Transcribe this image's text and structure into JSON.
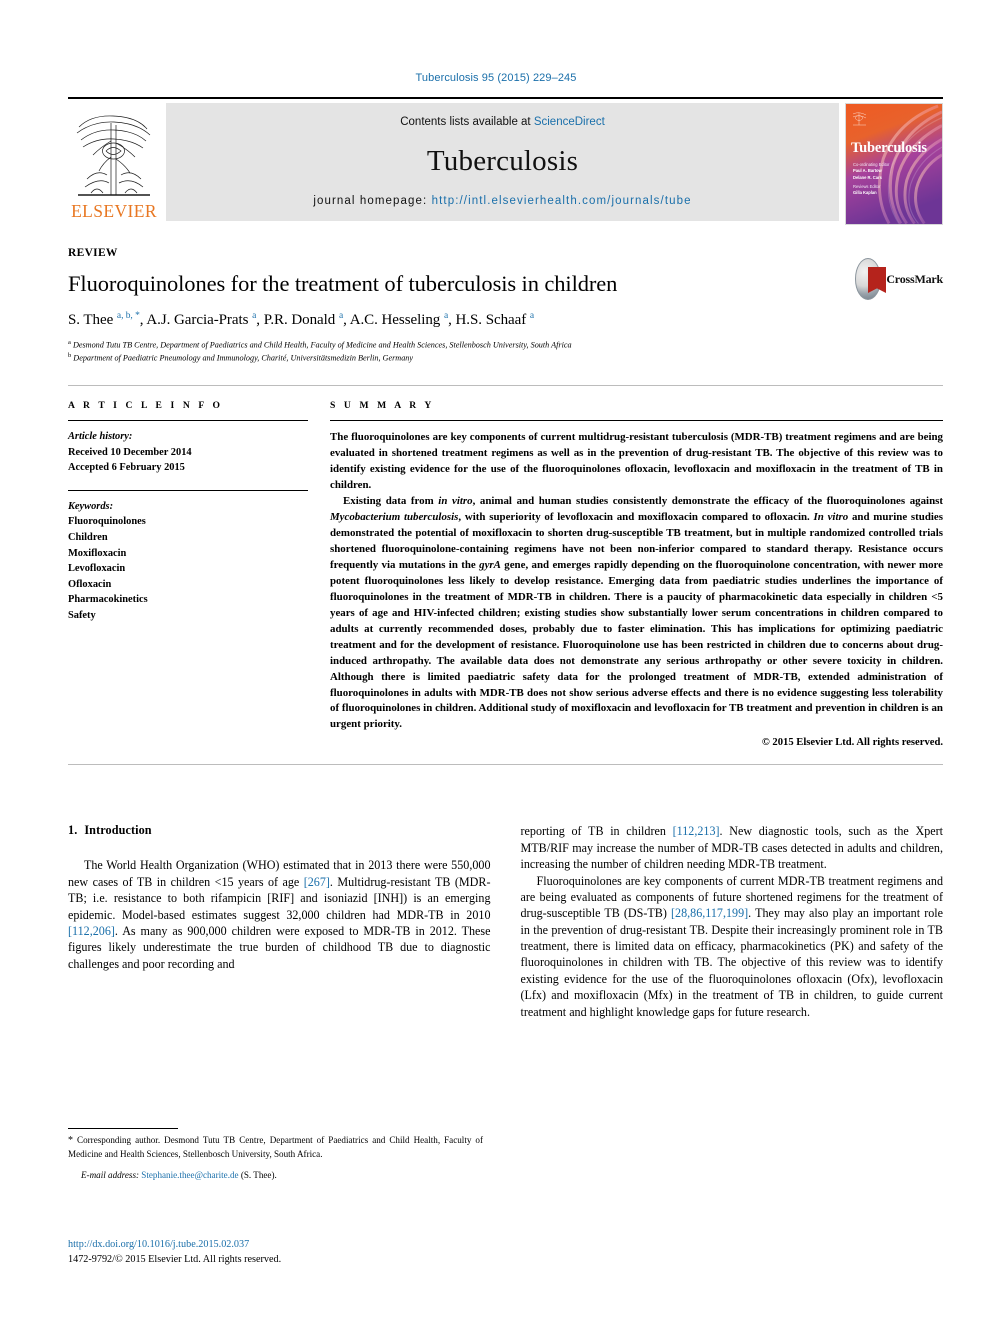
{
  "citation": "Tuberculosis 95 (2015) 229–245",
  "masthead": {
    "publisher_wordmark": "ELSEVIER",
    "contents_prefix": "Contents lists available at",
    "contents_link": "ScienceDirect",
    "journal_name": "Tuberculosis",
    "homepage_label": "journal homepage:",
    "homepage_url": "http://intl.elsevierhealth.com/journals/tube",
    "cover": {
      "title": "Tuberculosis",
      "line1_label": "Co-ordinating Editor",
      "line1": "Paul A. Bartow",
      "line2": "Delane R. Cars",
      "line3_label": "Reviews Editor",
      "line3": "Gilla Kaplan"
    }
  },
  "article": {
    "type_label": "REVIEW",
    "title": "Fluoroquinolones for the treatment of tuberculosis in children",
    "authors": [
      {
        "name": "S. Thee",
        "marks": "a, b, *"
      },
      {
        "name": "A.J. Garcia-Prats",
        "marks": "a"
      },
      {
        "name": "P.R. Donald",
        "marks": "a"
      },
      {
        "name": "A.C. Hesseling",
        "marks": "a"
      },
      {
        "name": "H.S. Schaaf",
        "marks": "a"
      }
    ],
    "affiliations": [
      {
        "mark": "a",
        "text": "Desmond Tutu TB Centre, Department of Paediatrics and Child Health, Faculty of Medicine and Health Sciences, Stellenbosch University, South Africa"
      },
      {
        "mark": "b",
        "text": "Department of Paediatric Pneumology and Immunology, Charité, Universitätsmedizin Berlin, Germany"
      }
    ],
    "crossmark_label": "CrossMark"
  },
  "article_info": {
    "heading": "A R T I C L E   I N F O",
    "history_label": "Article history:",
    "history": [
      "Received 10 December 2014",
      "Accepted 6 February 2015"
    ],
    "keywords_label": "Keywords:",
    "keywords": [
      "Fluoroquinolones",
      "Children",
      "Moxifloxacin",
      "Levofloxacin",
      "Ofloxacin",
      "Pharmacokinetics",
      "Safety"
    ]
  },
  "summary": {
    "heading": "S U M M A R Y",
    "paragraphs": [
      "The fluoroquinolones are key components of current multidrug-resistant tuberculosis (MDR-TB) treatment regimens and are being evaluated in shortened treatment regimens as well as in the prevention of drug-resistant TB. The objective of this review was to identify existing evidence for the use of the fluoroquinolones ofloxacin, levofloxacin and moxifloxacin in the treatment of TB in children.",
      "Existing data from in vitro, animal and human studies consistently demonstrate the efficacy of the fluoroquinolones against Mycobacterium tuberculosis, with superiority of levofloxacin and moxifloxacin compared to ofloxacin. In vitro and murine studies demonstrated the potential of moxifloxacin to shorten drug-susceptible TB treatment, but in multiple randomized controlled trials shortened fluoroquinolone-containing regimens have not been non-inferior compared to standard therapy. Resistance occurs frequently via mutations in the gyrA gene, and emerges rapidly depending on the fluoroquinolone concentration, with newer more potent fluoroquinolones less likely to develop resistance. Emerging data from paediatric studies underlines the importance of fluoroquinolones in the treatment of MDR-TB in children. There is a paucity of pharmacokinetic data especially in children <5 years of age and HIV-infected children; existing studies show substantially lower serum concentrations in children compared to adults at currently recommended doses, probably due to faster elimination. This has implications for optimizing paediatric treatment and for the development of resistance. Fluoroquinolone use has been restricted in children due to concerns about drug-induced arthropathy. The available data does not demonstrate any serious arthropathy or other severe toxicity in children. Although there is limited paediatric safety data for the prolonged treatment of MDR-TB, extended administration of fluoroquinolones in adults with MDR-TB does not show serious adverse effects and there is no evidence suggesting less tolerability of fluoroquinolones in children. Additional study of moxifloxacin and levofloxacin for TB treatment and prevention in children is an urgent priority."
    ],
    "copyright": "© 2015 Elsevier Ltd. All rights reserved."
  },
  "body": {
    "section_number": "1.",
    "section_title": "Introduction",
    "left_paragraphs": [
      "The World Health Organization (WHO) estimated that in 2013 there were 550,000 new cases of TB in children <15 years of age [267]. Multidrug-resistant TB (MDR-TB; i.e. resistance to both rifampicin [RIF] and isoniazid [INH]) is an emerging epidemic. Model-based estimates suggest 32,000 children had MDR-TB in 2010 [112,206]. As many as 900,000 children were exposed to MDR-TB in 2012. These figures likely underestimate the true burden of childhood TB due to diagnostic challenges and poor recording and"
    ],
    "right_paragraphs": [
      "reporting of TB in children [112,213]. New diagnostic tools, such as the Xpert MTB/RIF may increase the number of MDR-TB cases detected in adults and children, increasing the number of children needing MDR-TB treatment.",
      "Fluoroquinolones are key components of current MDR-TB treatment regimens and are being evaluated as components of future shortened regimens for the treatment of drug-susceptible TB (DS-TB) [28,86,117,199]. They may also play an important role in the prevention of drug-resistant TB. Despite their increasingly prominent role in TB treatment, there is limited data on efficacy, pharmacokinetics (PK) and safety of the fluoroquinolones in children with TB. The objective of this review was to identify existing evidence for the use of the fluoroquinolones ofloxacin (Ofx), levofloxacin (Lfx) and moxifloxacin (Mfx) in the treatment of TB in children, to guide current treatment and highlight knowledge gaps for future research."
    ],
    "references_inline": [
      "[267]",
      "[112,206]",
      "[112,213]",
      "[28,86,117,199]"
    ]
  },
  "footnote": {
    "corresponding": "* Corresponding author. Desmond Tutu TB Centre, Department of Paediatrics and Child Health, Faculty of Medicine and Health Sciences, Stellenbosch University, South Africa.",
    "email_label": "E-mail address:",
    "email": "Stephanie.thee@charite.de",
    "email_suffix": "(S. Thee)."
  },
  "imprint": {
    "doi": "http://dx.doi.org/10.1016/j.tube.2015.02.037",
    "issn_line": "1472-9792/© 2015 Elsevier Ltd. All rights reserved."
  },
  "colors": {
    "link": "#1a6faa",
    "elsevier_orange": "#E87722",
    "masthead_grey": "#e4e4e4",
    "crossmark_red": "#b5231c"
  }
}
